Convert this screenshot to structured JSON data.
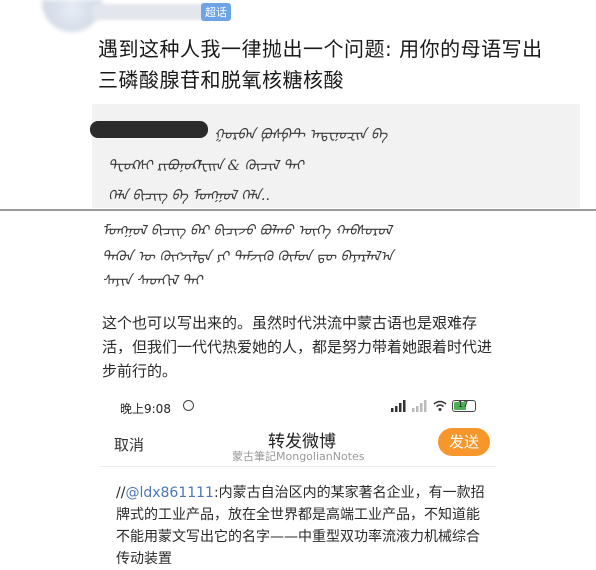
{
  "header": {
    "badge": "超话"
  },
  "post": {
    "text": "遇到这种人我一律抛出一个问题: 用你的母语写出 三磷酸腺苷和脱氧核糖核酸"
  },
  "quote": {
    "lines": [
      "ᠭᠤᠷᠪᠠᠨ ᠹᠤᠰᠹᠠᠲ ᠠᠳᠧᠨᠣᠽᠢᠨ ᠪᠠ",
      "ᠳᠧᠣᠺᠰᠢ ᠷᠢᠪᠣᠨᠤᠺᠯᠧᠢᠨ & ᠬᠦᠴᠢᠯ ᠲᠠᠢ",
      "ᠬᠡᠯᠡ ᠪᠢᠴᠢᠭ ᠪᠠ ᠮᠣᠩᠭᠣᠯ ᠬᠡᠯᠡ.."
    ]
  },
  "script_block": {
    "lines": [
      "ᠮᠣᠩᠭᠣᠯ ᠪᠢᠴᠢᠭ ᠪᠠᠷ ᠪᠢᠴᠢᠵᠦ ᠪᠣᠯᠬᠤ ᠦᠭᠡ ᠬᠠᠪᠰᠤᠷᠤᠯ",
      "ᠲᠡᠭᠦᠨ ᠦ ᠬᠥᠭᠵᠢᠯᠲᠡ ᠶᠢ ᠳᠡᠮᠵᠢᠬᠦ ᠬᠥᠮᠦᠨ ᠳᠦ ᠪᠠᠶᠠᠷᠯᠠᠯ᠎ᠠ",
      "ᠰᠠᠶᠢᠨ ᠰᠡᠳᠬᠢᠯ ᠲᠡᠢ"
    ]
  },
  "caption": "这个也可以写出来的。虽然时代洪流中蒙古语也是艰难存活，但我们一代代热爱她的人，都是努力带着她跟着时代进步前行的。",
  "phone": {
    "status_time": "晚上9:08",
    "battery": "17",
    "cancel_label": "取消",
    "title": "转发微博",
    "subtitle": "蒙古筆記MongolianNotes",
    "send_label": "发送",
    "repost_prefix": "//",
    "mention": "@ldx861111",
    "repost_text": ":内蒙古自治区内的某家著名企业，有一款招牌式的工业产品，放在全世界都是高端工业产品，不知道能不能用蒙文写出它的名字——中重型双功率流液力机械综合传动装置"
  },
  "colors": {
    "accent": "#f7972b",
    "mention": "#4a77b4",
    "quote_bg": "#f2f2f2"
  },
  "icons": [
    "alarm-icon",
    "signal-icon",
    "wifi-icon",
    "battery-icon"
  ]
}
